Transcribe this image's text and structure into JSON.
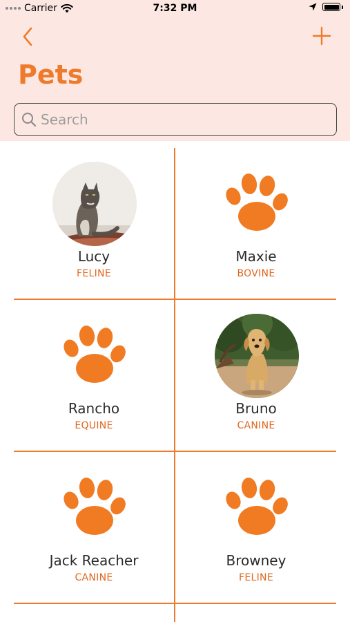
{
  "status_bar": {
    "carrier": "Carrier",
    "time": "7:32 PM"
  },
  "nav": {
    "back_icon": "chevron-left-icon",
    "add_icon": "plus-icon",
    "title": "Pets"
  },
  "search": {
    "placeholder": "Search",
    "value": "",
    "icon": "search-icon"
  },
  "colors": {
    "accent": "#ee7b2c",
    "header_bg": "#fce7e2",
    "kind_text": "#e1661d"
  },
  "pets": [
    {
      "name": "Lucy",
      "kind": "FELINE",
      "image": "cat-photo"
    },
    {
      "name": "Maxie",
      "kind": "BOVINE",
      "image": "paw-icon"
    },
    {
      "name": "Rancho",
      "kind": "EQUINE",
      "image": "paw-icon"
    },
    {
      "name": "Bruno",
      "kind": "CANINE",
      "image": "dog-photo"
    },
    {
      "name": "Jack Reacher",
      "kind": "CANINE",
      "image": "paw-icon"
    },
    {
      "name": "Browney",
      "kind": "FELINE",
      "image": "paw-icon"
    }
  ]
}
